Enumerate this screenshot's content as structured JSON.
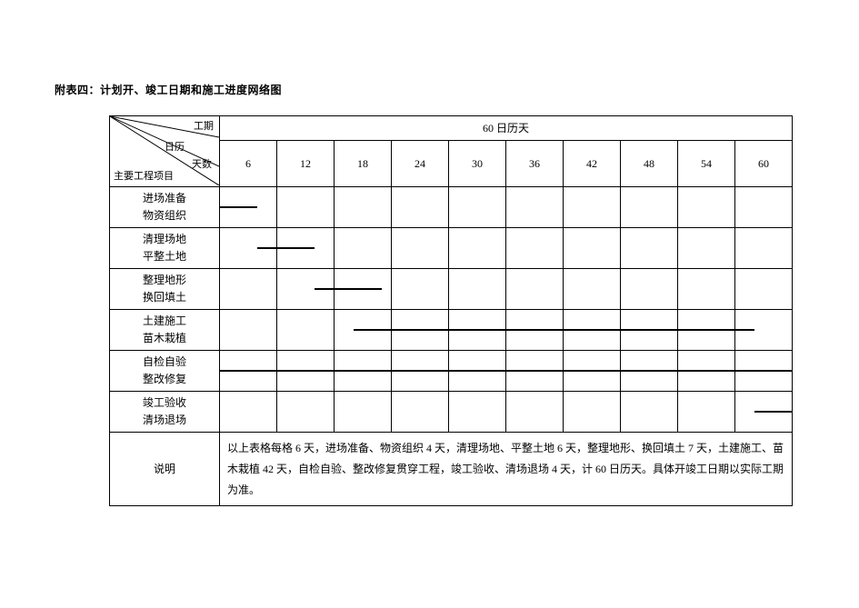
{
  "title": "附表四：计划开、竣工日期和施工进度网络图",
  "header": {
    "top": "工期",
    "mid": "日历",
    "bot": "天数",
    "bl": "主要工程项目",
    "period": "60 日历天",
    "days": [
      "6",
      "12",
      "18",
      "24",
      "30",
      "36",
      "42",
      "48",
      "54",
      "60"
    ]
  },
  "rows": [
    {
      "l1": "进场准备",
      "l2": "物资组织"
    },
    {
      "l1": "清理场地",
      "l2": "平整土地"
    },
    {
      "l1": "整理地形",
      "l2": "换回填土"
    },
    {
      "l1": "土建施工",
      "l2": "苗木栽植"
    },
    {
      "l1": "自检自验",
      "l2": "整改修复"
    },
    {
      "l1": "竣工验收",
      "l2": "清场退场"
    }
  ],
  "desc_label": "说明",
  "description": "以上表格每格 6 天，进场准备、物资组织 4 天，清理场地、平整土地 6 天，整理地形、换回填土 7 天，土建施工、苗木栽植 42 天，自检自验、整改修复贯穿工程，竣工验收、清场退场 4 天，计 60 日历天。具体开竣工日期以实际工期为准。",
  "chart_data": {
    "type": "bar",
    "title": "附表四：计划开、竣工日期和施工进度网络图",
    "xlabel": "日历天数",
    "ylabel": "主要工程项目",
    "x_ticks": [
      6,
      12,
      18,
      24,
      30,
      36,
      42,
      48,
      54,
      60
    ],
    "xlim": [
      0,
      60
    ],
    "series": [
      {
        "name": "进场准备 物资组织",
        "start": 0,
        "end": 4,
        "duration": 4
      },
      {
        "name": "清理场地 平整土地",
        "start": 4,
        "end": 10,
        "duration": 6
      },
      {
        "name": "整理地形 换回填土",
        "start": 10,
        "end": 17,
        "duration": 7
      },
      {
        "name": "土建施工 苗木栽植",
        "start": 14,
        "end": 56,
        "duration": 42
      },
      {
        "name": "自检自验 整改修复",
        "start": 0,
        "end": 60,
        "duration": 60
      },
      {
        "name": "竣工验收 清场退场",
        "start": 56,
        "end": 60,
        "duration": 4
      }
    ],
    "total_days": 60
  }
}
